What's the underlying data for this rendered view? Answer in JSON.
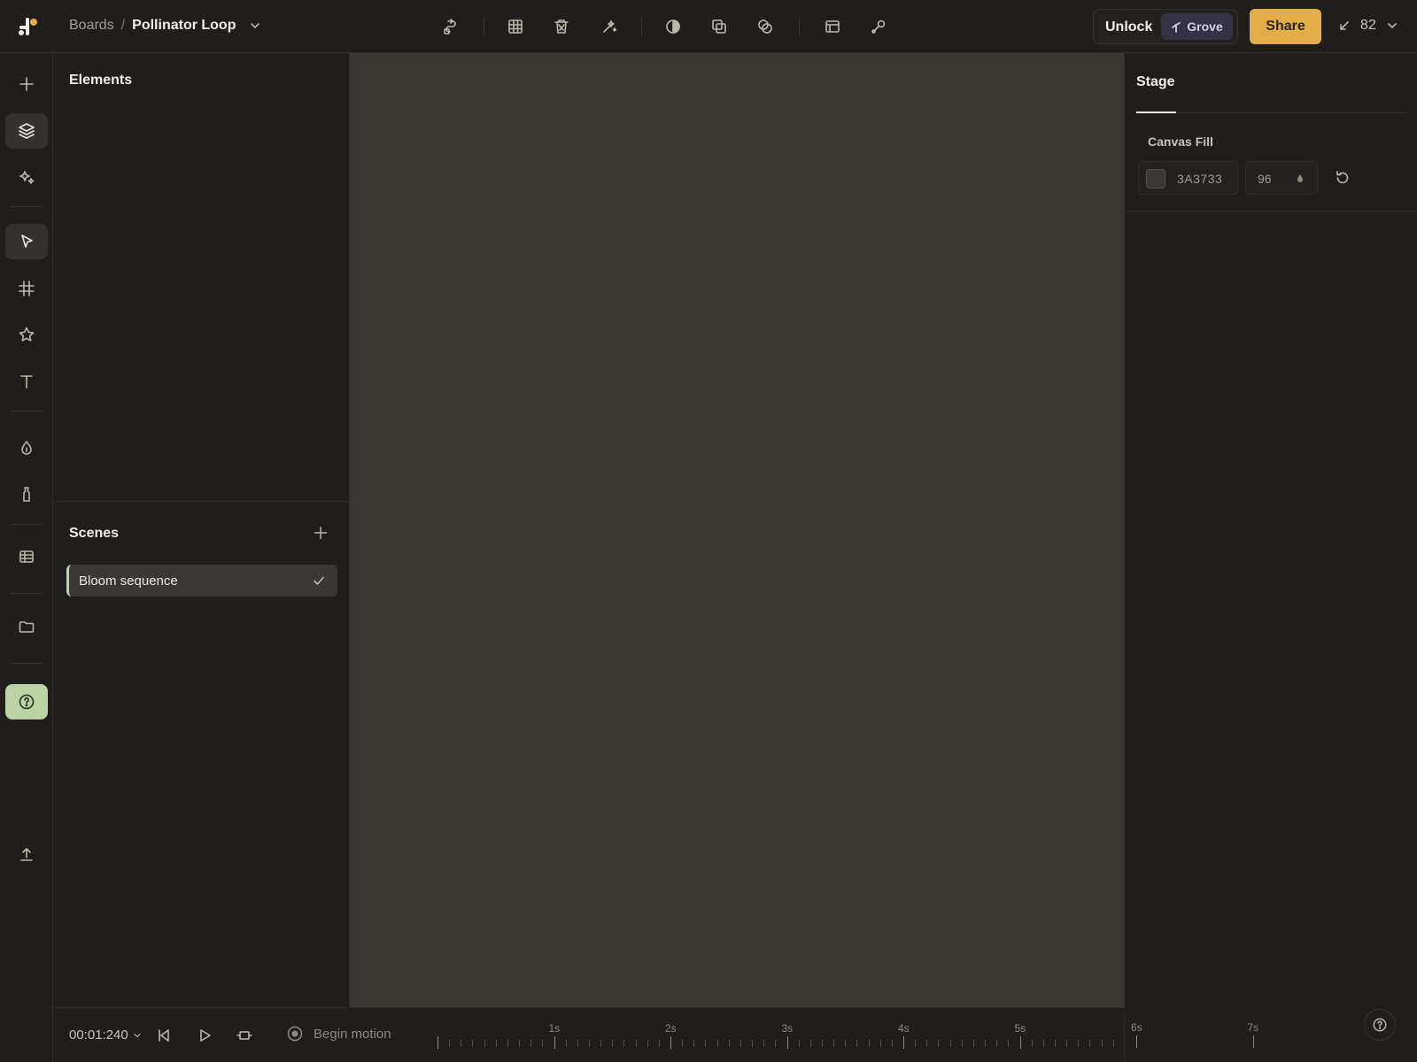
{
  "topbar": {
    "breadcrumb_root": "Boards",
    "breadcrumb_separator": "/",
    "project_name": "Pollinator Loop",
    "tools": [
      "route-icon",
      "grid-table-icon",
      "trash-icon",
      "magic-wand-icon",
      "contrast-icon",
      "duplicate-icon",
      "overlap-icon",
      "layout-icon",
      "wrench-icon"
    ],
    "unlock_label": "Unlock",
    "plan_badge": "Grove",
    "share_label": "Share",
    "zoom_value": "82"
  },
  "sidebar": {
    "items": [
      "plus-icon",
      "layers-icon",
      "sparkles-icon",
      "pointer-icon",
      "frame-grid-icon",
      "star-icon",
      "text-icon",
      "droplet-icon",
      "bottle-icon",
      "table-icon",
      "folder-icon",
      "help-icon",
      "upload-icon"
    ],
    "active": "pointer-icon"
  },
  "elements_panel": {
    "title": "Elements"
  },
  "scenes_panel": {
    "title": "Scenes",
    "items": [
      {
        "label": "Bloom sequence",
        "selected": true
      }
    ]
  },
  "inspector": {
    "tab": "Stage",
    "canvas_fill": {
      "label": "Canvas Fill",
      "hex": "3A3733",
      "opacity": "96"
    }
  },
  "timeline": {
    "time": "00:01:240",
    "begin_motion_label": "Begin motion",
    "ruler_labels": [
      "1s",
      "2s",
      "3s",
      "4s",
      "5s",
      "6s",
      "7s"
    ]
  },
  "colors": {
    "accent_share": "#E3AD48",
    "accent_green": "#BCD4A4",
    "canvas": "#3A3733",
    "plan_badge_bg": "#343146"
  }
}
